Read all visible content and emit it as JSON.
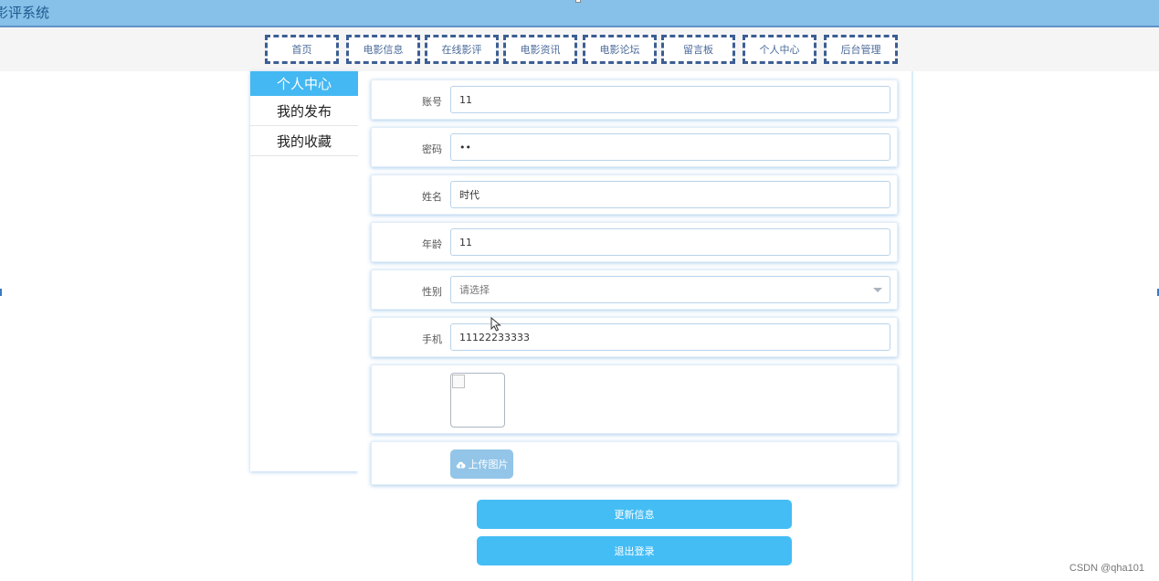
{
  "app": {
    "title": "影评系统"
  },
  "nav": {
    "items": [
      "首页",
      "电影信息",
      "在线影评",
      "电影资讯",
      "电影论坛",
      "留言板",
      "个人中心",
      "后台管理"
    ]
  },
  "sidebar": {
    "items": [
      "个人中心",
      "我的发布",
      "我的收藏"
    ],
    "active_index": 0
  },
  "form": {
    "account": {
      "label": "账号",
      "value": "11"
    },
    "password": {
      "label": "密码",
      "value": "••"
    },
    "name": {
      "label": "姓名",
      "value": "时代"
    },
    "age": {
      "label": "年龄",
      "value": "11"
    },
    "gender": {
      "label": "性别",
      "placeholder": "请选择"
    },
    "phone": {
      "label": "手机",
      "value": "11122233333"
    },
    "upload_label": "上传图片"
  },
  "actions": {
    "update": "更新信息",
    "logout": "退出登录"
  },
  "watermark": "CSDN @qha101",
  "icons": {
    "upload": "cloud-upload-icon",
    "dropdown": "chevron-down-icon",
    "pointer": "mouse-pointer-icon"
  },
  "colors": {
    "accent": "#44b8f2",
    "titlebar": "#87c1e9",
    "nav_border": "#3c5e93"
  }
}
